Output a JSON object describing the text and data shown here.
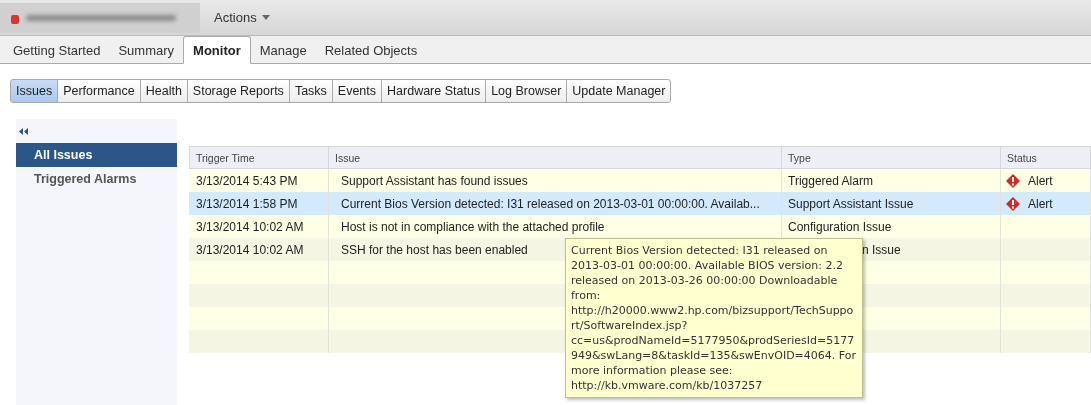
{
  "header": {
    "actions_label": "Actions"
  },
  "tabs": [
    {
      "label": "Getting Started",
      "selected": false
    },
    {
      "label": "Summary",
      "selected": false
    },
    {
      "label": "Monitor",
      "selected": true
    },
    {
      "label": "Manage",
      "selected": false
    },
    {
      "label": "Related Objects",
      "selected": false
    }
  ],
  "subtabs": [
    {
      "label": "Issues",
      "selected": true
    },
    {
      "label": "Performance",
      "selected": false
    },
    {
      "label": "Health",
      "selected": false
    },
    {
      "label": "Storage Reports",
      "selected": false
    },
    {
      "label": "Tasks",
      "selected": false
    },
    {
      "label": "Events",
      "selected": false
    },
    {
      "label": "Hardware Status",
      "selected": false
    },
    {
      "label": "Log Browser",
      "selected": false
    },
    {
      "label": "Update Manager",
      "selected": false
    }
  ],
  "sidebar": {
    "items": [
      {
        "label": "All Issues",
        "selected": true
      },
      {
        "label": "Triggered Alarms",
        "selected": false
      }
    ]
  },
  "table": {
    "columns": [
      "Trigger Time",
      "Issue",
      "Type",
      "Status"
    ],
    "rows": [
      {
        "time": "3/13/2014 5:43 PM",
        "issue": "Support Assistant has found issues",
        "type": "Triggered Alarm",
        "status": "Alert",
        "selected": false,
        "type_covered": false
      },
      {
        "time": "3/13/2014 1:58 PM",
        "issue": "Current Bios Version detected: I31 released on 2013-03-01 00:00:00.  Availab...",
        "type": "Support Assistant Issue",
        "status": "Alert",
        "selected": true,
        "type_covered": false
      },
      {
        "time": "3/13/2014 10:02 AM",
        "issue": "Host is not in compliance with the attached profile",
        "type": "Configuration Issue",
        "selected": false,
        "type_covered": false
      },
      {
        "time": "3/13/2014 10:02 AM",
        "issue": "SSH for the host has been enabled",
        "type": "n Issue",
        "selected": false,
        "type_covered": true
      }
    ]
  },
  "tooltip": {
    "text": "Current Bios Version detected: I31 released on 2013-03-01 00:00:00.  Available BIOS version: 2.2 released on 2013-03-26 00:00:00 Downloadable from: http://h20000.www2.hp.com/bizsupport/TechSupport/SoftwareIndex.jsp?cc=us&prodNameId=5177950&prodSeriesId=5177949&swLang=8&taskId=135&swEnvOID=4064. For more information please see: http://kb.vmware.com/kb/1037257"
  }
}
